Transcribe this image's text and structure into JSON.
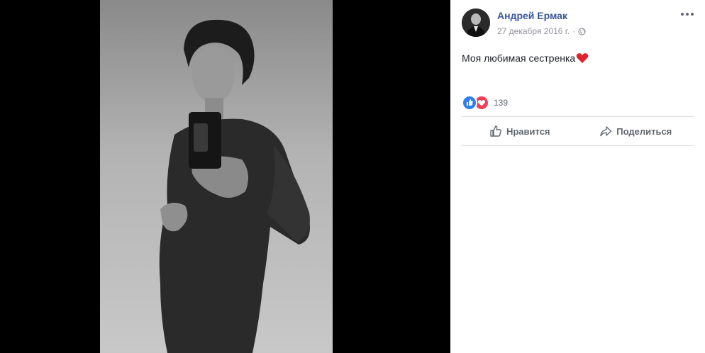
{
  "post": {
    "author": "Андрей Ермак",
    "date": "27 декабря 2016 г.",
    "separator": "·",
    "text": "Моя любимая сестренка",
    "reaction_count": "139"
  },
  "actions": {
    "like_label": "Нравится",
    "share_label": "Поделиться"
  },
  "icons": [
    "globe-icon",
    "more-options-icon",
    "heart-emoji-icon",
    "like-reaction-icon",
    "love-reaction-icon",
    "like-icon",
    "share-icon"
  ],
  "colors": {
    "author_link": "#385898",
    "secondary_text": "#90949c",
    "like_blue": "#2f7ff0",
    "love_red": "#f33e58"
  }
}
